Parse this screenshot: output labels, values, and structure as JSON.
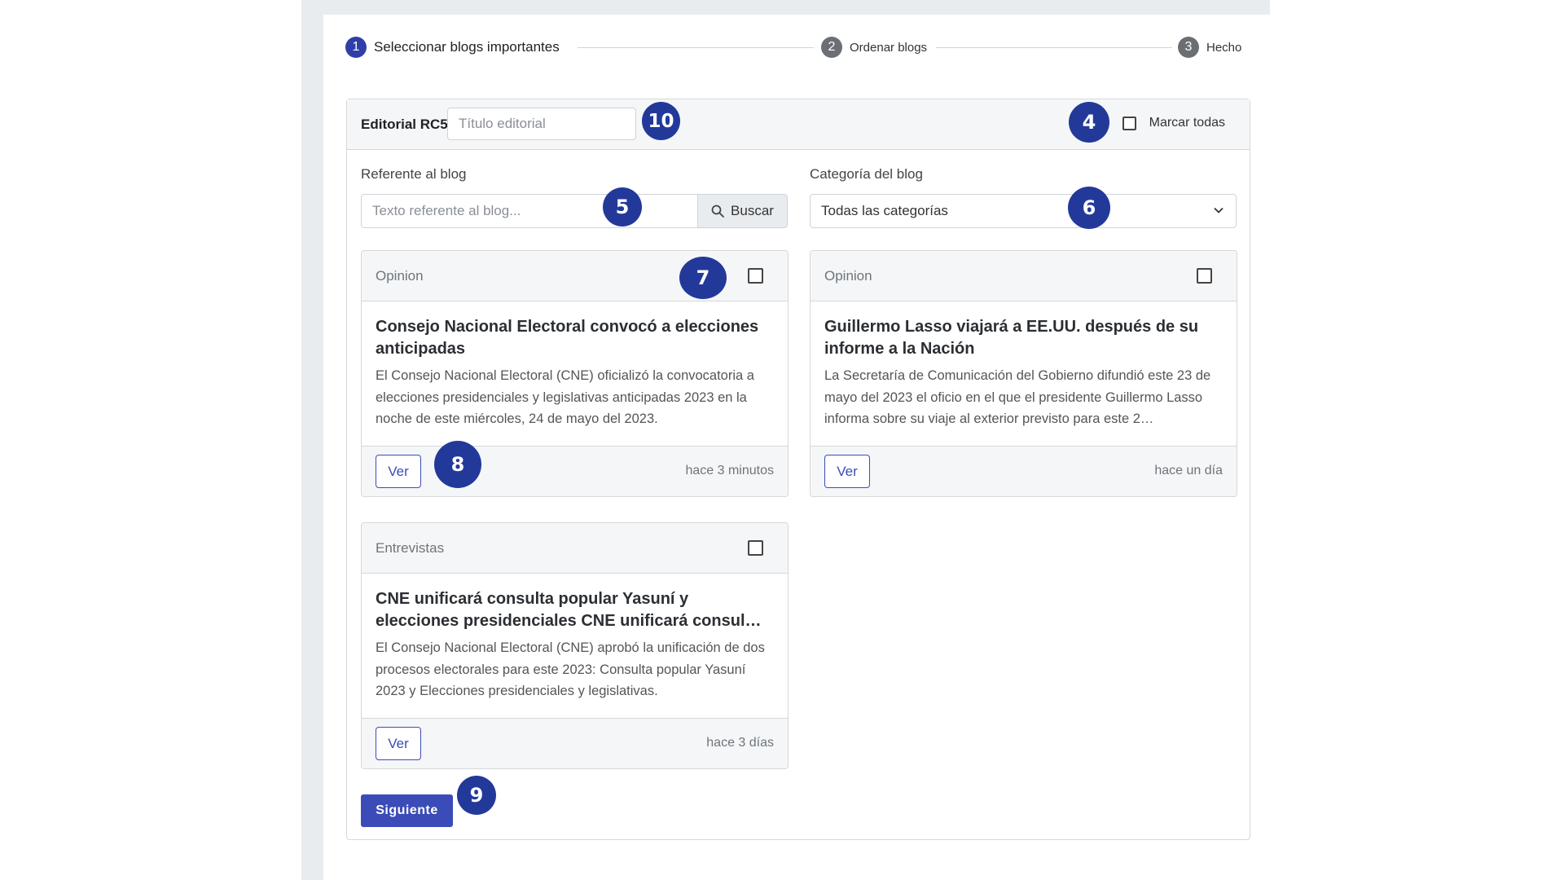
{
  "stepper": {
    "steps": [
      {
        "number": "1",
        "label": "Seleccionar blogs importantes",
        "state": "active"
      },
      {
        "number": "2",
        "label": "Ordenar blogs",
        "state": "pending"
      },
      {
        "number": "3",
        "label": "Hecho",
        "state": "pending"
      }
    ]
  },
  "header": {
    "editorial_label": "Editorial RC5",
    "title_placeholder": "Título editorial",
    "mark_all_label": "Marcar todas"
  },
  "filters": {
    "search_label": "Referente al blog",
    "search_placeholder": "Texto referente al blog...",
    "search_button": "Buscar",
    "category_label": "Categoría del blog",
    "category_selected": "Todas las categorías"
  },
  "cards": [
    {
      "category": "Opinion",
      "title": "Consejo Nacional Electoral convocó a elecciones anticipadas",
      "description": "El Consejo Nacional Electoral (CNE) oficializó la convocatoria a elecciones presidenciales y legislativas anticipadas 2023 en la noche de este miércoles, 24 de mayo del 2023.",
      "view_label": "Ver",
      "time": "hace 3 minutos"
    },
    {
      "category": "Opinion",
      "title": "Guillermo Lasso viajará a EE.UU. después de su informe a la Nación",
      "description": "La Secretaría de Comunicación del Gobierno difundió este 23 de mayo del 2023 el oficio en el que el presidente Guillermo Lasso informa sobre su viaje al exterior previsto para este 2…",
      "view_label": "Ver",
      "time": "hace un día"
    },
    {
      "category": "Entrevistas",
      "title": "CNE unificará consulta popular Yasuní y elecciones presidenciales CNE unificará consul…",
      "description": "El Consejo Nacional Electoral (CNE) aprobó la unificación de dos procesos electorales para este 2023: Consulta popular Yasuní 2023 y Elecciones presidenciales y legislativas.",
      "view_label": "Ver",
      "time": "hace 3 días"
    }
  ],
  "next_button": "Siguiente",
  "annotations": [
    "4",
    "5",
    "6",
    "7",
    "8",
    "9",
    "10"
  ],
  "colors": {
    "accent": "#3b4cb8",
    "step_active": "#2f3fa8",
    "step_inactive": "#6b6f74",
    "badge": "#23399a",
    "panel_header_bg": "#f5f6f7",
    "rail_bg": "#e9ecef"
  }
}
